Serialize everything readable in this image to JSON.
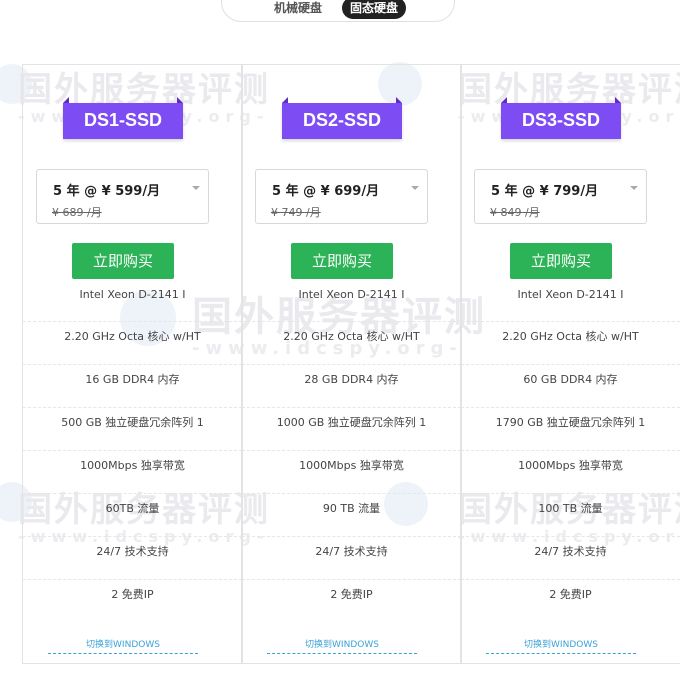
{
  "toggle": {
    "hdd_label": "机械硬盘",
    "ssd_label": "固态硬盘",
    "active": "ssd"
  },
  "watermark": {
    "text": "国外服务器评测",
    "url": "-www.idcspy.org-"
  },
  "colors": {
    "ribbon": "#7e4cf3",
    "buy_button": "#2db357",
    "link": "#39a2d6"
  },
  "plans": [
    {
      "name": "DS1-SSD",
      "term": "5 年 @ ¥ 599/月",
      "original": "¥ 689 /月",
      "buy_label": "立即购买",
      "specs": [
        "Intel Xeon D-2141 I",
        "2.20 GHz Octa 核心 w/HT",
        "16 GB DDR4 内存",
        "500 GB 独立硬盘冗余阵列 1",
        "1000Mbps 独享带宽",
        "60TB 流量",
        "24/7 技术支持",
        "2 免费IP"
      ],
      "os_link": "切换到WINDOWS"
    },
    {
      "name": "DS2-SSD",
      "term": "5 年 @ ¥ 699/月",
      "original": "¥ 749 /月",
      "buy_label": "立即购买",
      "specs": [
        "Intel Xeon D-2141 I",
        "2.20 GHz Octa 核心 w/HT",
        "28 GB DDR4 内存",
        "1000 GB 独立硬盘冗余阵列 1",
        "1000Mbps 独享带宽",
        "90 TB 流量",
        "24/7 技术支持",
        "2 免费IP"
      ],
      "os_link": "切换到WINDOWS"
    },
    {
      "name": "DS3-SSD",
      "term": "5 年 @ ¥ 799/月",
      "original": "¥ 849 /月",
      "buy_label": "立即购买",
      "specs": [
        "Intel Xeon D-2141 I",
        "2.20 GHz Octa 核心 w/HT",
        "60 GB DDR4 内存",
        "1790 GB 独立硬盘冗余阵列 1",
        "1000Mbps 独享带宽",
        "100 TB 流量",
        "24/7 技术支持",
        "2 免费IP"
      ],
      "os_link": "切换到WINDOWS"
    }
  ]
}
